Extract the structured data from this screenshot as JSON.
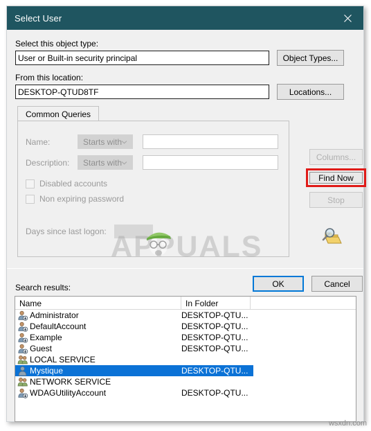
{
  "window": {
    "title": "Select User",
    "close_icon": "close-icon",
    "titlebar_color": "#1f5560"
  },
  "object_type": {
    "label": "Select this object type:",
    "value": "User or Built-in security principal",
    "button": "Object Types..."
  },
  "location": {
    "label": "From this location:",
    "value": "DESKTOP-QTUD8TF",
    "button": "Locations..."
  },
  "tabs": [
    {
      "label": "Common Queries",
      "active": true
    }
  ],
  "query": {
    "name_label": "Name:",
    "name_operator": "Starts with",
    "name_value": "",
    "description_label": "Description:",
    "description_operator": "Starts with",
    "description_value": "",
    "disabled_accounts_label": "Disabled accounts",
    "disabled_accounts_checked": false,
    "non_expiring_password_label": "Non expiring password",
    "non_expiring_password_checked": false,
    "days_since_logon_label": "Days since last logon:",
    "days_since_logon_value": ""
  },
  "side_buttons": {
    "columns": "Columns...",
    "columns_enabled": false,
    "find_now": "Find Now",
    "find_now_highlighted": true,
    "highlight_color": "#e01b18",
    "stop": "Stop",
    "stop_enabled": false,
    "search_icon": "magnifier-folder-icon"
  },
  "dialog_buttons": {
    "ok": "OK",
    "cancel": "Cancel",
    "ok_focus_color": "#0078d7"
  },
  "results": {
    "label": "Search results:",
    "columns": [
      "Name",
      "In Folder",
      ""
    ],
    "selection_color": "#0b72d6",
    "rows": [
      {
        "name": "Administrator",
        "folder": "DESKTOP-QTU...",
        "icon": "user-account-icon",
        "selected": false
      },
      {
        "name": "DefaultAccount",
        "folder": "DESKTOP-QTU...",
        "icon": "user-account-icon",
        "selected": false
      },
      {
        "name": "Example",
        "folder": "DESKTOP-QTU...",
        "icon": "user-account-icon",
        "selected": false
      },
      {
        "name": "Guest",
        "folder": "DESKTOP-QTU...",
        "icon": "user-account-icon",
        "selected": false
      },
      {
        "name": "LOCAL SERVICE",
        "folder": "",
        "icon": "user-group-icon",
        "selected": false
      },
      {
        "name": "Mystique",
        "folder": "DESKTOP-QTU...",
        "icon": "user-plain-icon",
        "selected": true
      },
      {
        "name": "NETWORK SERVICE",
        "folder": "",
        "icon": "user-group-icon",
        "selected": false
      },
      {
        "name": "WDAGUtilityAccount",
        "folder": "DESKTOP-QTU...",
        "icon": "user-account-icon",
        "selected": false
      }
    ]
  },
  "watermarks": {
    "center": "APPUALS",
    "corner": "wsxdn.com"
  }
}
